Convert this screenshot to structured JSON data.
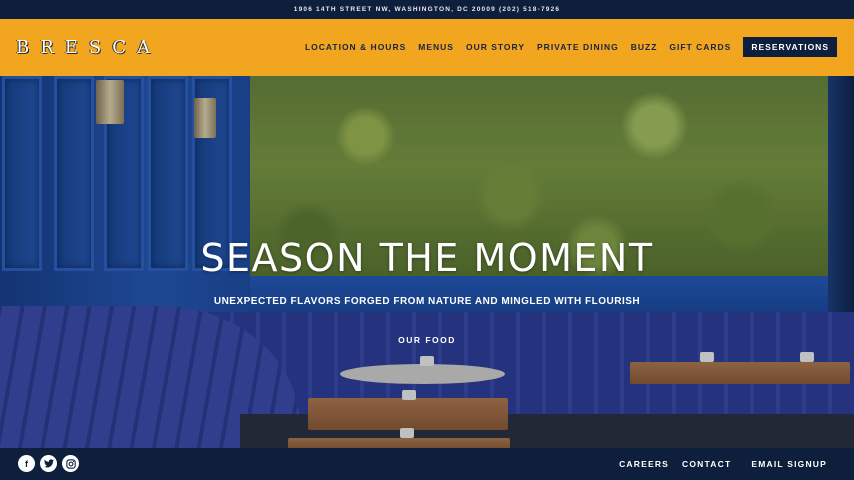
{
  "topbar": {
    "address": "1906 14TH STREET NW, WASHINGTON, DC 20009   (202) 518-7926"
  },
  "header": {
    "logo": "BRESCA",
    "nav": [
      "LOCATION & HOURS",
      "MENUS",
      "OUR STORY",
      "PRIVATE DINING",
      "BUZZ",
      "GIFT CARDS"
    ],
    "reservations": "RESERVATIONS"
  },
  "hero": {
    "title": "SEASON THE MOMENT",
    "subtitle": "UNEXPECTED FLAVORS FORGED FROM NATURE AND MINGLED WITH FLOURISH",
    "cta": "OUR FOOD"
  },
  "footer": {
    "social": [
      "facebook-icon",
      "twitter-icon",
      "instagram-icon"
    ],
    "links": [
      "CAREERS",
      "CONTACT"
    ],
    "signup": "EMAIL SIGNUP"
  },
  "colors": {
    "accent": "#f2a51e",
    "navy": "#0e1f3d"
  }
}
